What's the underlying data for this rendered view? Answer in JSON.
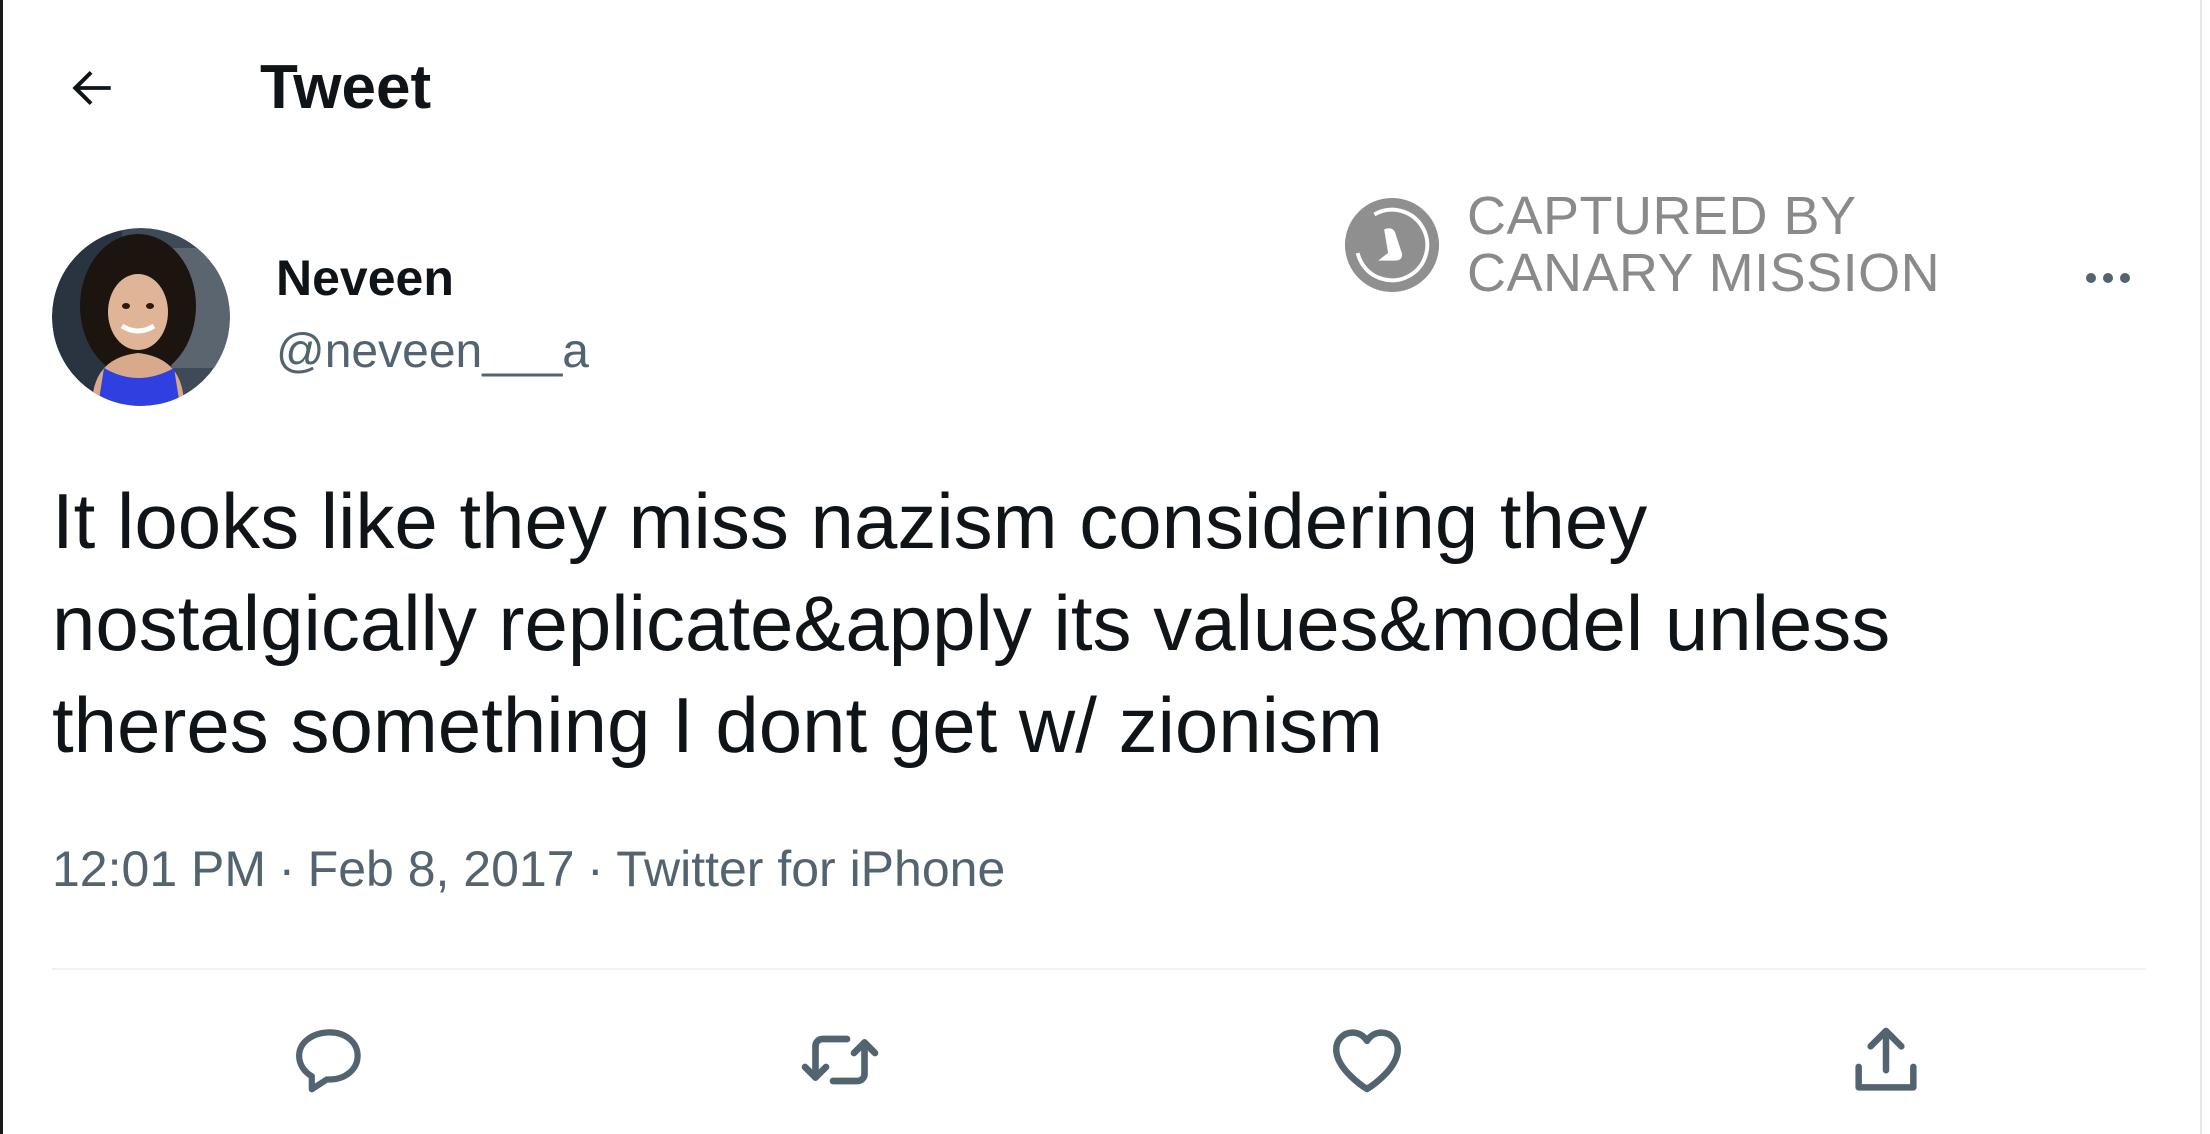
{
  "header": {
    "title": "Tweet",
    "back_icon": "arrow-left-icon"
  },
  "author": {
    "name": "Neveen",
    "handle": "@neveen___a",
    "avatar_icon": "profile-photo"
  },
  "watermark": {
    "line1": "CAPTURED BY",
    "line2": "CANARY MISSION",
    "logo_icon": "canary-bird-logo",
    "color": "#8a8a8a"
  },
  "tweet": {
    "text": "It looks like they miss nazism considering they\nnostalgically replicate&apply its values&model unless\ntheres something I dont get w/ zionism",
    "time": "12:01 PM",
    "date": "Feb 8, 2017",
    "source": "Twitter for iPhone",
    "separator": "·"
  },
  "actions": [
    {
      "name": "reply",
      "icon": "reply-icon"
    },
    {
      "name": "retweet",
      "icon": "retweet-icon"
    },
    {
      "name": "like",
      "icon": "heart-icon"
    },
    {
      "name": "share",
      "icon": "share-icon"
    }
  ],
  "colors": {
    "text": "#0f1419",
    "secondary": "#536471",
    "divider": "#eff3f4",
    "avatar_dress": "#2f3fe0"
  }
}
